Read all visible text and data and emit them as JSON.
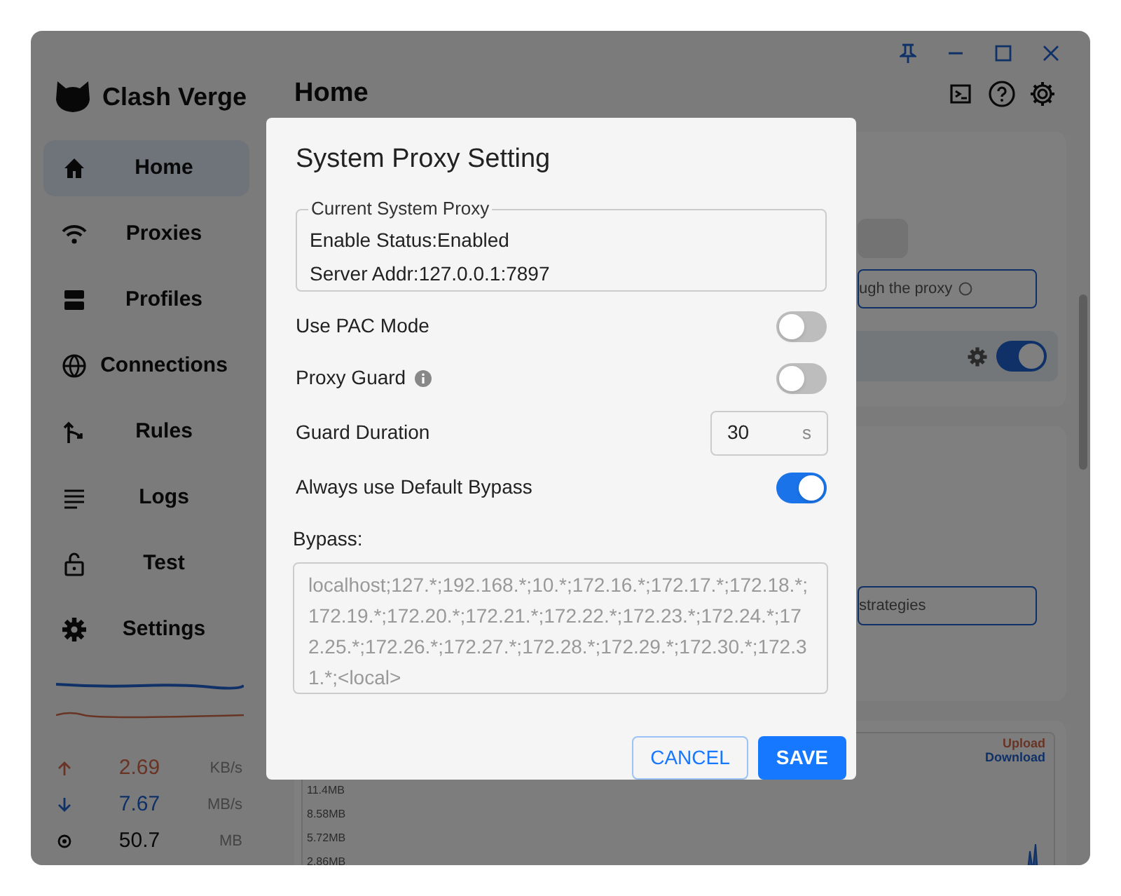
{
  "app": {
    "name": "Clash Verge"
  },
  "sidebar": {
    "items": [
      {
        "label": "Home",
        "kind": "home",
        "selected": true
      },
      {
        "label": "Proxies",
        "kind": "proxies",
        "selected": false
      },
      {
        "label": "Profiles",
        "kind": "profiles",
        "selected": false
      },
      {
        "label": "Connections",
        "kind": "connections",
        "selected": false
      },
      {
        "label": "Rules",
        "kind": "rules",
        "selected": false
      },
      {
        "label": "Logs",
        "kind": "logs",
        "selected": false
      },
      {
        "label": "Test",
        "kind": "test",
        "selected": false
      },
      {
        "label": "Settings",
        "kind": "settings",
        "selected": false
      }
    ],
    "stats": [
      {
        "kind": "upload",
        "value": "2.69",
        "unit": "KB/s"
      },
      {
        "kind": "download",
        "value": "7.67",
        "unit": "MB/s"
      },
      {
        "kind": "memory",
        "value": "50.7",
        "unit": "MB"
      }
    ]
  },
  "page": {
    "title": "Home",
    "proxy_card": {
      "field_text": "ugh the proxy",
      "toggle_on": true
    },
    "mode_card": {
      "field_text": "strategies"
    },
    "traffic_card": {
      "y_labels": [
        "11.4MB",
        "8.58MB",
        "5.72MB",
        "2.86MB"
      ],
      "legend": [
        "Upload",
        "Download"
      ]
    }
  },
  "dialog": {
    "title": "System Proxy Setting",
    "current": {
      "legend": "Current System Proxy",
      "lines": [
        "Enable Status:Enabled",
        "Server Addr:127.0.0.1:7897"
      ]
    },
    "settings": [
      {
        "kind": "toggle",
        "label": "Use PAC Mode",
        "on": false
      },
      {
        "kind": "toggle",
        "label": "Proxy Guard",
        "info": true,
        "on": false
      },
      {
        "kind": "number",
        "label": "Guard Duration",
        "value": "30",
        "unit": "s"
      },
      {
        "kind": "toggle",
        "label": "Always use Default Bypass",
        "on": true
      }
    ],
    "bypass": {
      "label": "Bypass:",
      "value": "localhost;127.*;192.168.*;10.*;172.16.*;172.17.*;172.18.*;172.19.*;172.20.*;172.21.*;172.22.*;172.23.*;172.24.*;172.25.*;172.26.*;172.27.*;172.28.*;172.29.*;172.30.*;172.31.*;<local>"
    },
    "buttons": [
      {
        "kind": "secondary",
        "label": "CANCEL"
      },
      {
        "kind": "primary",
        "label": "SAVE"
      }
    ]
  }
}
